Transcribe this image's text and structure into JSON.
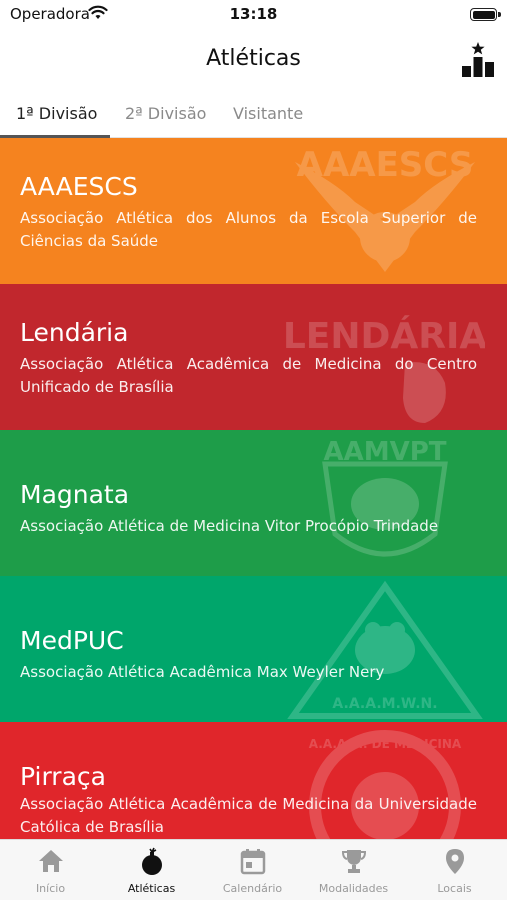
{
  "status_bar": {
    "carrier": "Operadora",
    "time": "13:18"
  },
  "header": {
    "title": "Atléticas",
    "ranking_icon": "podium-icon"
  },
  "tabs": [
    {
      "label": "1ª Divisão",
      "active": true
    },
    {
      "label": "2ª Divisão",
      "active": false
    },
    {
      "label": "Visitante",
      "active": false
    }
  ],
  "athletics": [
    {
      "name": "AAAESCS",
      "description": "Associação Atlética dos Alunos da Escola Superior de Ciências da Saúde",
      "color": "#F5831F",
      "crest_text": "AAAESCS"
    },
    {
      "name": "Lendária",
      "description": "Associação Atlética Acadêmica de Medicina do Centro Unificado de Brasília",
      "color": "#C1272D",
      "crest_text": "LENDÁRIA"
    },
    {
      "name": "Magnata",
      "description": "Associação Atlética de Medicina Vitor Procópio Trindade",
      "color": "#1E9D49",
      "crest_text": "AAMVPT"
    },
    {
      "name": "MedPUC",
      "description": "Associação Atlética Acadêmica Max Weyler Nery",
      "color": "#00A66B",
      "crest_text": "A.A.A.M.W.N."
    },
    {
      "name": "Pirraça",
      "description": "Associação Atlética Acadêmica de Medicina da Universidade Católica de Brasília",
      "color": "#E0262B",
      "crest_text": "A.A.A.M. DE MEDICINA"
    }
  ],
  "tab_bar": [
    {
      "label": "Início",
      "icon": "home-icon",
      "active": false
    },
    {
      "label": "Atléticas",
      "icon": "bomb-icon",
      "active": true
    },
    {
      "label": "Calendário",
      "icon": "calendar-icon",
      "active": false
    },
    {
      "label": "Modalidades",
      "icon": "trophy-icon",
      "active": false
    },
    {
      "label": "Locais",
      "icon": "location-pin-icon",
      "active": false
    }
  ]
}
